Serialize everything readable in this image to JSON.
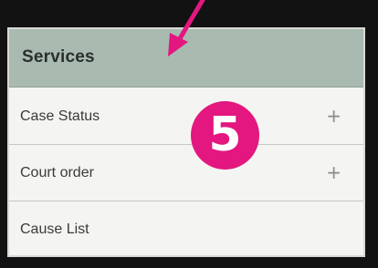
{
  "panel": {
    "title": "Services",
    "items": [
      {
        "label": "Case Status",
        "expand_icon": "+"
      },
      {
        "label": "Court order",
        "expand_icon": "+"
      },
      {
        "label": "Cause List"
      }
    ]
  },
  "annotation": {
    "step_number": "5",
    "color": "#e3177f"
  }
}
